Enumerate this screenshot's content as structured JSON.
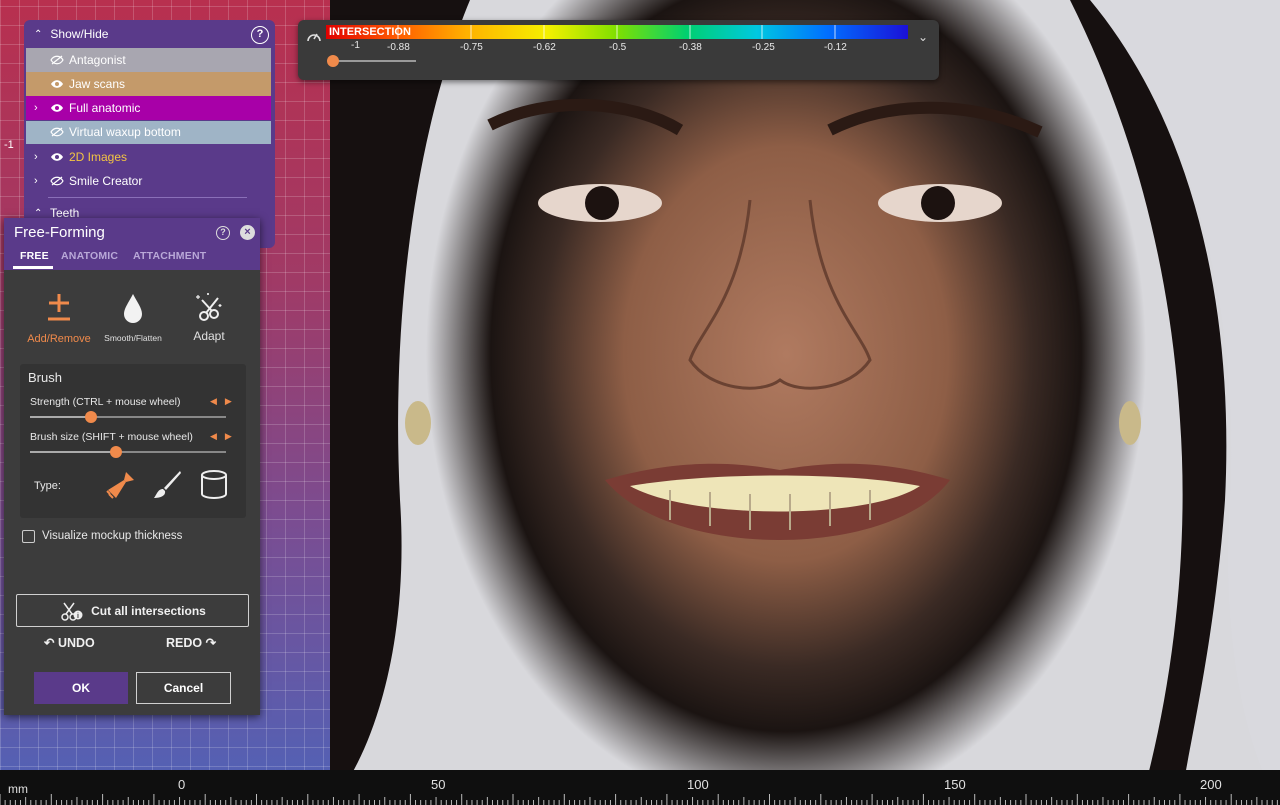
{
  "intersection_scale": {
    "title": "INTERSECTION",
    "tick_labels": [
      "-1",
      "-0.88",
      "-0.75",
      "-0.62",
      "-0.5",
      "-0.38",
      "-0.25",
      "-0.12"
    ],
    "slider_value": 0
  },
  "show_hide": {
    "title": "Show/Hide",
    "help": "?",
    "items": [
      {
        "label": "Antagonist",
        "visible": false
      },
      {
        "label": "Jaw scans",
        "visible": false
      },
      {
        "label": "Full anatomic",
        "visible": true,
        "expandable": true
      },
      {
        "label": "Virtual waxup bottom",
        "visible": false
      },
      {
        "label": "2D Images",
        "visible": true,
        "expandable": true
      },
      {
        "label": "Smile Creator",
        "visible": false,
        "expandable": true
      }
    ],
    "teeth_label": "Teeth"
  },
  "free_forming": {
    "title": "Free-Forming",
    "help": "?",
    "close": "×",
    "tabs": [
      "FREE",
      "ANATOMIC",
      "ATTACHMENT"
    ],
    "active_tab": "FREE",
    "tools": [
      {
        "label": "Add/Remove",
        "icon": "add-remove-icon",
        "active": true
      },
      {
        "label": "Smooth/Flatten",
        "icon": "drop-icon",
        "active": false
      },
      {
        "label": "Adapt",
        "icon": "adapt-icon",
        "active": false
      }
    ],
    "brush": {
      "title": "Brush",
      "strength_label": "Strength (CTRL + mouse wheel)",
      "strength_value": 0.31,
      "size_label": "Brush size (SHIFT + mouse wheel)",
      "size_value": 0.44,
      "type_label": "Type:",
      "types": [
        "broom-brush-icon",
        "paint-brush-icon",
        "cylinder-icon"
      ],
      "active_type": "broom-brush-icon"
    },
    "visualize_label": "Visualize mockup thickness",
    "visualize_checked": false,
    "cut_label": "Cut all intersections",
    "undo_label": "UNDO",
    "redo_label": "REDO",
    "ok_label": "OK",
    "cancel_label": "Cancel"
  },
  "ruler": {
    "unit": "mm",
    "labels": [
      "0",
      "50",
      "100",
      "150",
      "200"
    ]
  },
  "side_marker": "-1",
  "colors": {
    "accent": "#f08a4b",
    "panel_purple": "#5a3a8a",
    "panel_dark": "#3c3c3c"
  }
}
